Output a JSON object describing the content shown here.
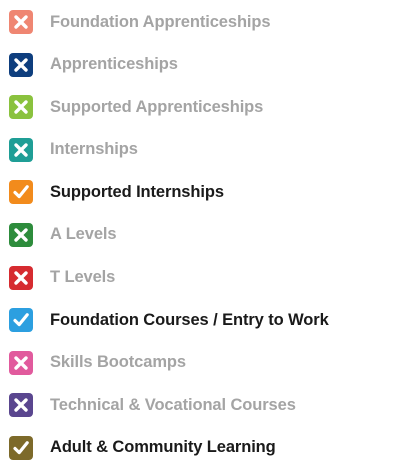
{
  "items": [
    {
      "label": "Foundation Apprenticeships",
      "status": "cross",
      "color": "#ef8672",
      "active": false
    },
    {
      "label": "Apprenticeships",
      "status": "cross",
      "color": "#0e3e7e",
      "active": false
    },
    {
      "label": "Supported Apprenticeships",
      "status": "cross",
      "color": "#8ac23e",
      "active": false
    },
    {
      "label": "Internships",
      "status": "cross",
      "color": "#1f9e96",
      "active": false
    },
    {
      "label": "Supported Internships",
      "status": "check",
      "color": "#f28b1c",
      "active": true
    },
    {
      "label": "A Levels",
      "status": "cross",
      "color": "#2d8c3c",
      "active": false
    },
    {
      "label": "T Levels",
      "status": "cross",
      "color": "#d62b30",
      "active": false
    },
    {
      "label": "Foundation Courses / Entry to Work",
      "status": "check",
      "color": "#2c9fe0",
      "active": true
    },
    {
      "label": "Skills Bootcamps",
      "status": "cross",
      "color": "#e15a9d",
      "active": false
    },
    {
      "label": "Technical & Vocational Courses",
      "status": "cross",
      "color": "#5a468f",
      "active": false
    },
    {
      "label": "Adult & Community Learning",
      "status": "check",
      "color": "#7d6a2a",
      "active": true
    }
  ],
  "icons": {
    "cross": "cross-icon",
    "check": "check-icon"
  }
}
